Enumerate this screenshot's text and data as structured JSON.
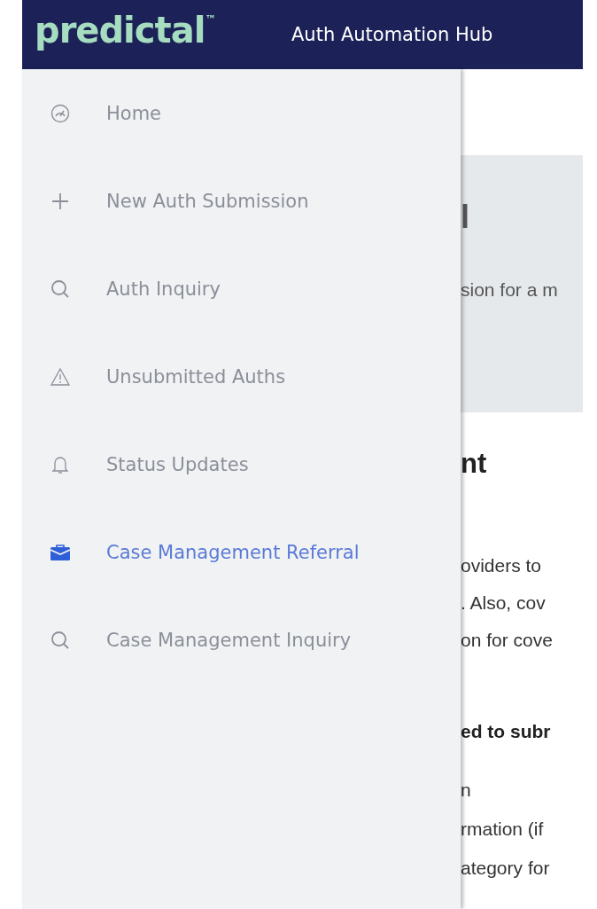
{
  "header": {
    "logo": "predictal$^{™}$",
    "title": "Auth Automation Hub"
  },
  "sidebar": {
    "items": [
      {
        "label": "Home",
        "kind": "gauge",
        "selected": false
      },
      {
        "label": "New Auth Submission",
        "kind": "plus",
        "selected": false
      },
      {
        "label": "Auth Inquiry",
        "kind": "search",
        "selected": false
      },
      {
        "label": "Unsubmitted Auths",
        "kind": "warning",
        "selected": false
      },
      {
        "label": "Status Updates",
        "kind": "bell",
        "selected": false
      },
      {
        "label": "Case Management Referral",
        "kind": "briefcase",
        "selected": true
      },
      {
        "label": "Case Management Inquiry",
        "kind": "search",
        "selected": false
      }
    ]
  },
  "content": {
    "banner": {
      "title": "l",
      "subtitle": "sion for a m"
    },
    "section_title": "nt",
    "paragraph": [
      "oviders to",
      ". Also, cov",
      "on for cove"
    ],
    "subheading": "ed to subr",
    "list": [
      "n",
      "rmation (if",
      "ategory for"
    ]
  }
}
